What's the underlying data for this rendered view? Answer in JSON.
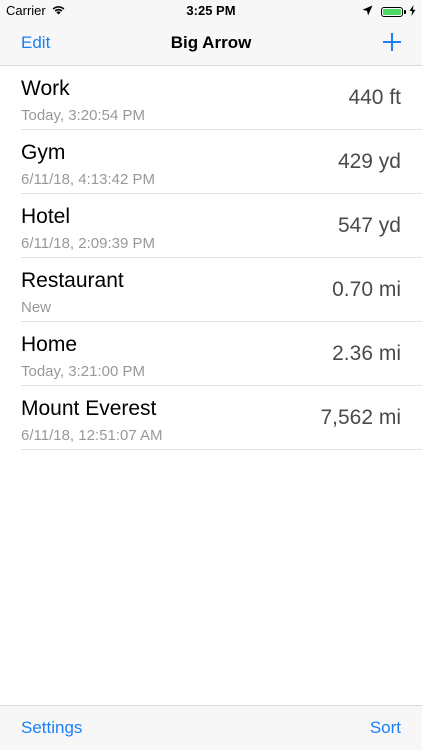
{
  "status_bar": {
    "carrier": "Carrier",
    "time": "3:25 PM",
    "icons": [
      "wifi-icon",
      "location-icon",
      "battery-icon",
      "charging-icon"
    ],
    "battery_color": "#4cd964"
  },
  "nav": {
    "edit_label": "Edit",
    "title": "Big Arrow",
    "add_icon": "plus-icon",
    "accent_color": "#1a7ff5"
  },
  "places": [
    {
      "name": "Work",
      "subtitle": "Today, 3:20:54 PM",
      "distance": "440 ft"
    },
    {
      "name": "Gym",
      "subtitle": "6/11/18, 4:13:42 PM",
      "distance": "429 yd"
    },
    {
      "name": "Hotel",
      "subtitle": "6/11/18, 2:09:39 PM",
      "distance": "547 yd"
    },
    {
      "name": "Restaurant",
      "subtitle": "New",
      "distance": "0.70 mi"
    },
    {
      "name": "Home",
      "subtitle": "Today, 3:21:00 PM",
      "distance": "2.36 mi"
    },
    {
      "name": "Mount Everest",
      "subtitle": "6/11/18, 12:51:07 AM",
      "distance": "7,562 mi"
    }
  ],
  "toolbar": {
    "settings_label": "Settings",
    "sort_label": "Sort"
  }
}
